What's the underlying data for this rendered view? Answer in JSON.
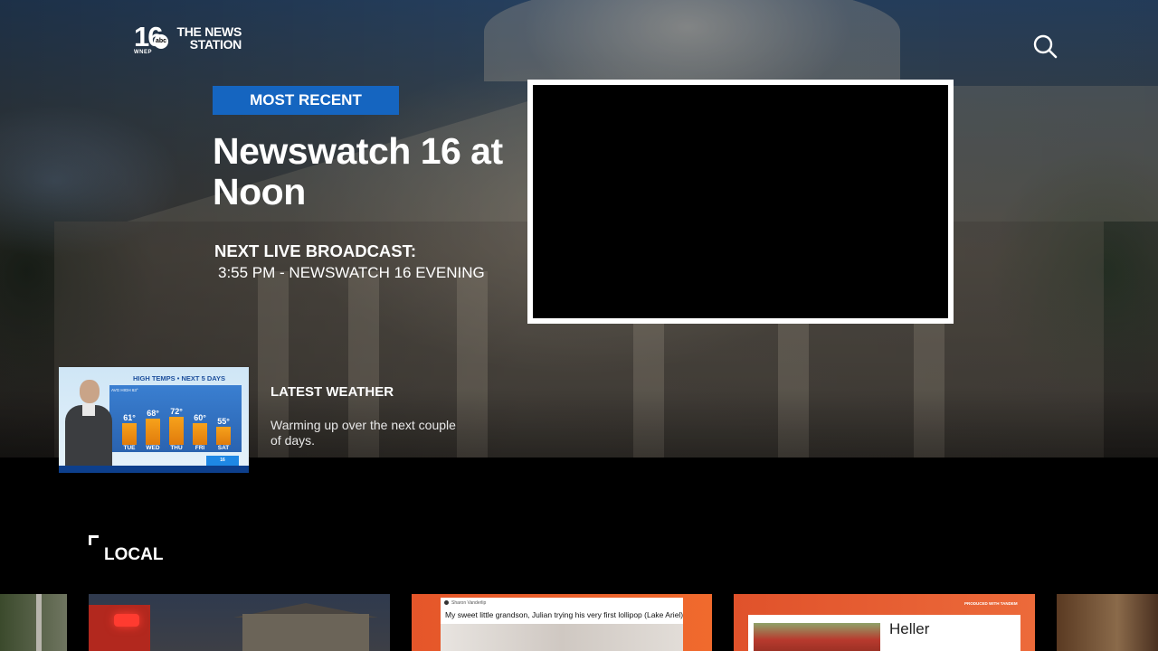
{
  "header": {
    "logo": {
      "channel_number": "16",
      "network": "abc",
      "call_sign": "WNEP",
      "station_name_line1": "THE NEWS",
      "station_name_line2": "STATION"
    },
    "search_icon": "search-icon"
  },
  "hero": {
    "badge": "MOST RECENT",
    "headline": "Newswatch 16 at Noon",
    "next_broadcast_label": "NEXT LIVE BROADCAST:",
    "next_broadcast_value": "3:55 PM - NEWSWATCH 16 EVENING"
  },
  "weather": {
    "title": "LATEST WEATHER",
    "description": "Warming up over the next couple of days.",
    "thumbnail": {
      "banner": "HIGH TEMPS • NEXT 5 DAYS",
      "avg_label": "AVG HIGH 63°",
      "forecast": [
        {
          "day": "TUE",
          "temp": "61°",
          "value": 61
        },
        {
          "day": "WED",
          "temp": "68°",
          "value": 68
        },
        {
          "day": "THU",
          "temp": "72°",
          "value": 72
        },
        {
          "day": "FRI",
          "temp": "60°",
          "value": 60
        },
        {
          "day": "SAT",
          "temp": "55°",
          "value": 55
        }
      ]
    }
  },
  "local": {
    "title": "LOCAL",
    "cards": [
      {
        "caption": "My sweet little grandson, Julian trying his very first lollipop (Lake Ariel)",
        "poster": "Sharon Vanderlip"
      },
      {
        "promo": "PRODUCED WITH TANDEM",
        "headline": "Heller"
      }
    ]
  },
  "colors": {
    "badge_blue": "#1565c0",
    "card_orange": "#e5562a",
    "background": "#000000"
  }
}
